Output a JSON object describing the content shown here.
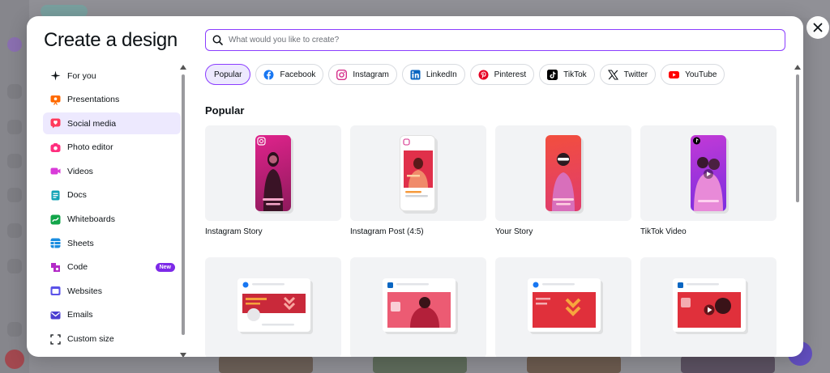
{
  "dialog": {
    "title": "Create a design",
    "search_placeholder": "What would you like to create?"
  },
  "nav": {
    "items": [
      {
        "label": "For you",
        "icon": "sparkle-icon",
        "color": "#0d1216"
      },
      {
        "label": "Presentations",
        "icon": "presentation-icon",
        "color": "#ff6a00"
      },
      {
        "label": "Social media",
        "icon": "heart-chat-icon",
        "color": "#ff3b5c",
        "active": true
      },
      {
        "label": "Photo editor",
        "icon": "camera-icon",
        "color": "#ff2e7e"
      },
      {
        "label": "Videos",
        "icon": "video-icon",
        "color": "#d93ad9"
      },
      {
        "label": "Docs",
        "icon": "doc-icon",
        "color": "#13a3b5"
      },
      {
        "label": "Whiteboards",
        "icon": "whiteboard-icon",
        "color": "#12a54a"
      },
      {
        "label": "Sheets",
        "icon": "sheet-icon",
        "color": "#1a8de0"
      },
      {
        "label": "Code",
        "icon": "code-icon",
        "color": "#b32bc7",
        "badge": "New"
      },
      {
        "label": "Websites",
        "icon": "website-icon",
        "color": "#5a52e8"
      },
      {
        "label": "Emails",
        "icon": "email-icon",
        "color": "#4b3fd1"
      },
      {
        "label": "Custom size",
        "icon": "custom-size-icon",
        "color": "#0d1216"
      }
    ]
  },
  "chips": [
    {
      "label": "Popular",
      "active": true
    },
    {
      "label": "Facebook",
      "icon": "facebook-icon"
    },
    {
      "label": "Instagram",
      "icon": "instagram-icon"
    },
    {
      "label": "LinkedIn",
      "icon": "linkedin-icon"
    },
    {
      "label": "Pinterest",
      "icon": "pinterest-icon"
    },
    {
      "label": "TikTok",
      "icon": "tiktok-icon"
    },
    {
      "label": "Twitter",
      "icon": "x-icon"
    },
    {
      "label": "YouTube",
      "icon": "youtube-icon"
    }
  ],
  "section": {
    "title": "Popular"
  },
  "cards": [
    {
      "label": "Instagram Story"
    },
    {
      "label": "Instagram Post (4:5)"
    },
    {
      "label": "Your Story"
    },
    {
      "label": "TikTok Video"
    }
  ],
  "colors": {
    "accent": "#8b3dff",
    "active_bg": "#ede9fe",
    "brand_red": "#e2323f",
    "brand_pink": "#d62f8b"
  }
}
